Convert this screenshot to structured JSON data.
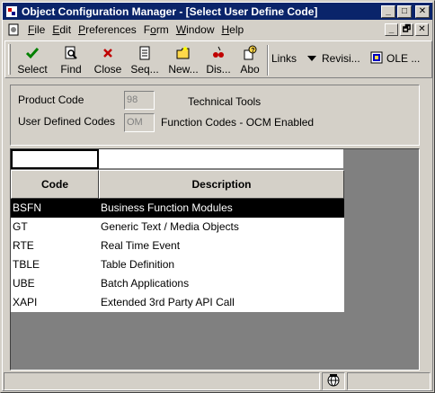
{
  "window": {
    "title": "Object Configuration Manager - [Select User Define Code]",
    "minimize": "_",
    "maximize": "□",
    "close": "✕"
  },
  "menu": {
    "items": [
      "File",
      "Edit",
      "Preferences",
      "Form",
      "Window",
      "Help"
    ],
    "mdi_min": "_",
    "mdi_restore": "🗗",
    "mdi_close": "✕"
  },
  "toolbar": {
    "select": "Select",
    "find": "Find",
    "close": "Close",
    "seq": "Seq...",
    "new": "New...",
    "dis": "Dis...",
    "abo": "Abo",
    "links": "Links",
    "revisi": "Revisi...",
    "ole": "OLE ..."
  },
  "header": {
    "product_code_label": "Product Code",
    "product_code_value": "98",
    "product_code_desc": "Technical Tools",
    "udc_label": "User Defined Codes",
    "udc_value": "OM",
    "udc_desc": "Function Codes - OCM Enabled"
  },
  "grid": {
    "columns": [
      "Code",
      "Description"
    ],
    "rows": [
      {
        "code": "BSFN",
        "desc": "Business Function Modules"
      },
      {
        "code": "GT",
        "desc": "Generic Text / Media Objects"
      },
      {
        "code": "RTE",
        "desc": "Real Time Event"
      },
      {
        "code": "TBLE",
        "desc": "Table Definition"
      },
      {
        "code": "UBE",
        "desc": "Batch Applications"
      },
      {
        "code": "XAPI",
        "desc": "Extended 3rd Party API Call"
      }
    ],
    "selected_index": 0
  },
  "colors": {
    "titlebar": "#0a246a",
    "face": "#d4d0c8",
    "selection": "#000000"
  }
}
